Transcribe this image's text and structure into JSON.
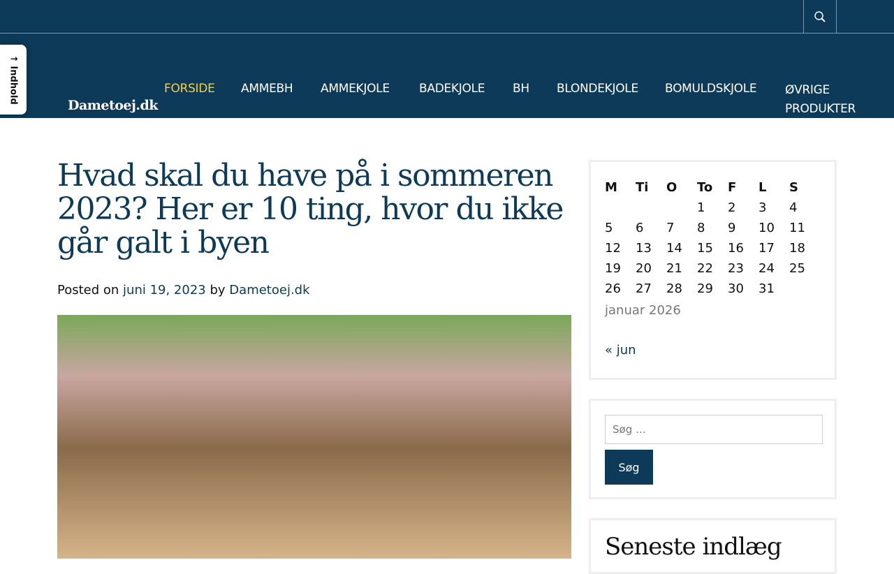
{
  "skip_link": "↑ Indhold",
  "site_title": "Dametoej.dk",
  "menu": [
    "FORSIDE",
    "AMMEBH",
    "AMMEKJOLE",
    "BADEKJOLE",
    "BH",
    "BLONDEKJOLE",
    "BOMULDSKJOLE",
    "ØVRIGE PRODUKTER"
  ],
  "post": {
    "title": "Hvad skal du have på i sommeren 2023? Her er 10 ting, hvor du ikke går galt i byen",
    "posted_on": "Posted on",
    "date": "juni 19, 2023",
    "by": "by",
    "author": "Dametoej.dk"
  },
  "calendar": {
    "headers": [
      "M",
      "Ti",
      "O",
      "To",
      "F",
      "L",
      "S"
    ],
    "rows": [
      [
        "",
        "",
        "",
        "1",
        "2",
        "3",
        "4"
      ],
      [
        "5",
        "6",
        "7",
        "8",
        "9",
        "10",
        "11"
      ],
      [
        "12",
        "13",
        "14",
        "15",
        "16",
        "17",
        "18"
      ],
      [
        "19",
        "20",
        "21",
        "22",
        "23",
        "24",
        "25"
      ],
      [
        "26",
        "27",
        "28",
        "29",
        "30",
        "31",
        ""
      ]
    ],
    "caption": "januar 2026",
    "prev": "« jun"
  },
  "search": {
    "placeholder": "Søg …",
    "button": "Søg"
  },
  "recent": {
    "title": "Seneste indlæg"
  }
}
